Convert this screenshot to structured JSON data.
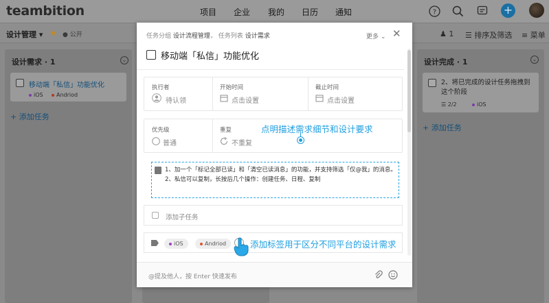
{
  "app": {
    "logo": "teambition"
  },
  "topnav": {
    "links": [
      "项目",
      "企业",
      "我的",
      "日历",
      "通知"
    ],
    "plus": "+"
  },
  "project": {
    "name": "设计管理 ▾",
    "star": "★",
    "visibility": "公开",
    "member_count": "1",
    "sort_filter": "排序及筛选",
    "menu": "菜单"
  },
  "columns": [
    {
      "title": "设计需求 · 1",
      "add_task": "添加任务",
      "cards": [
        {
          "title": "移动端「私信」功能优化",
          "tags": [
            {
              "label": "iOS",
              "color": "#7e3aa8"
            },
            {
              "label": "Andriod",
              "color": "#b23a1a"
            }
          ]
        }
      ]
    },
    {
      "title": "设计完成 · 1",
      "add_task": "添加任务",
      "cards": [
        {
          "title": "2、将已完成的设计任务拖拽到这个阶段",
          "subtasks": "2/2",
          "tags": [
            {
              "label": "iOS",
              "color": "#7e3aa8"
            }
          ]
        }
      ]
    }
  ],
  "modal": {
    "crumb_group_label": "任务分组",
    "crumb_group": "设计流程管理",
    "crumb_sep": "，",
    "crumb_list_label": "任务列表",
    "crumb_list": "设计需求",
    "more": "更多",
    "close": "✕",
    "title": "移动端「私信」功能优化",
    "fields": {
      "assignee_label": "执行者",
      "assignee_value": "待认领",
      "start_label": "开始时间",
      "start_value": "点击设置",
      "due_label": "截止时间",
      "due_value": "点击设置",
      "priority_label": "优先级",
      "priority_value": "普通",
      "repeat_label": "重复",
      "repeat_value": "不重复"
    },
    "description": [
      "1、加一个「标记全部已读」和「清空已读消息」的功能，并支持筛选「仅@我」的消息。",
      "2、私信可以复制，长按后几个操作：创建任务、日程、复制"
    ],
    "add_subtask": "添加子任务",
    "tags": [
      {
        "label": "iOS",
        "color": "#a040c8"
      },
      {
        "label": "Andriod",
        "color": "#e0552a"
      }
    ],
    "comment_placeholder": "@提及他人，按 Enter 快速发布"
  },
  "annotations": {
    "description_hint": "点明描述需求细节和设计要求",
    "tag_hint": "添加标签用于区分不同平台的设计需求"
  },
  "colors": {
    "accent": "#1e9ee0",
    "brand_plus": "#1b6fa3"
  }
}
